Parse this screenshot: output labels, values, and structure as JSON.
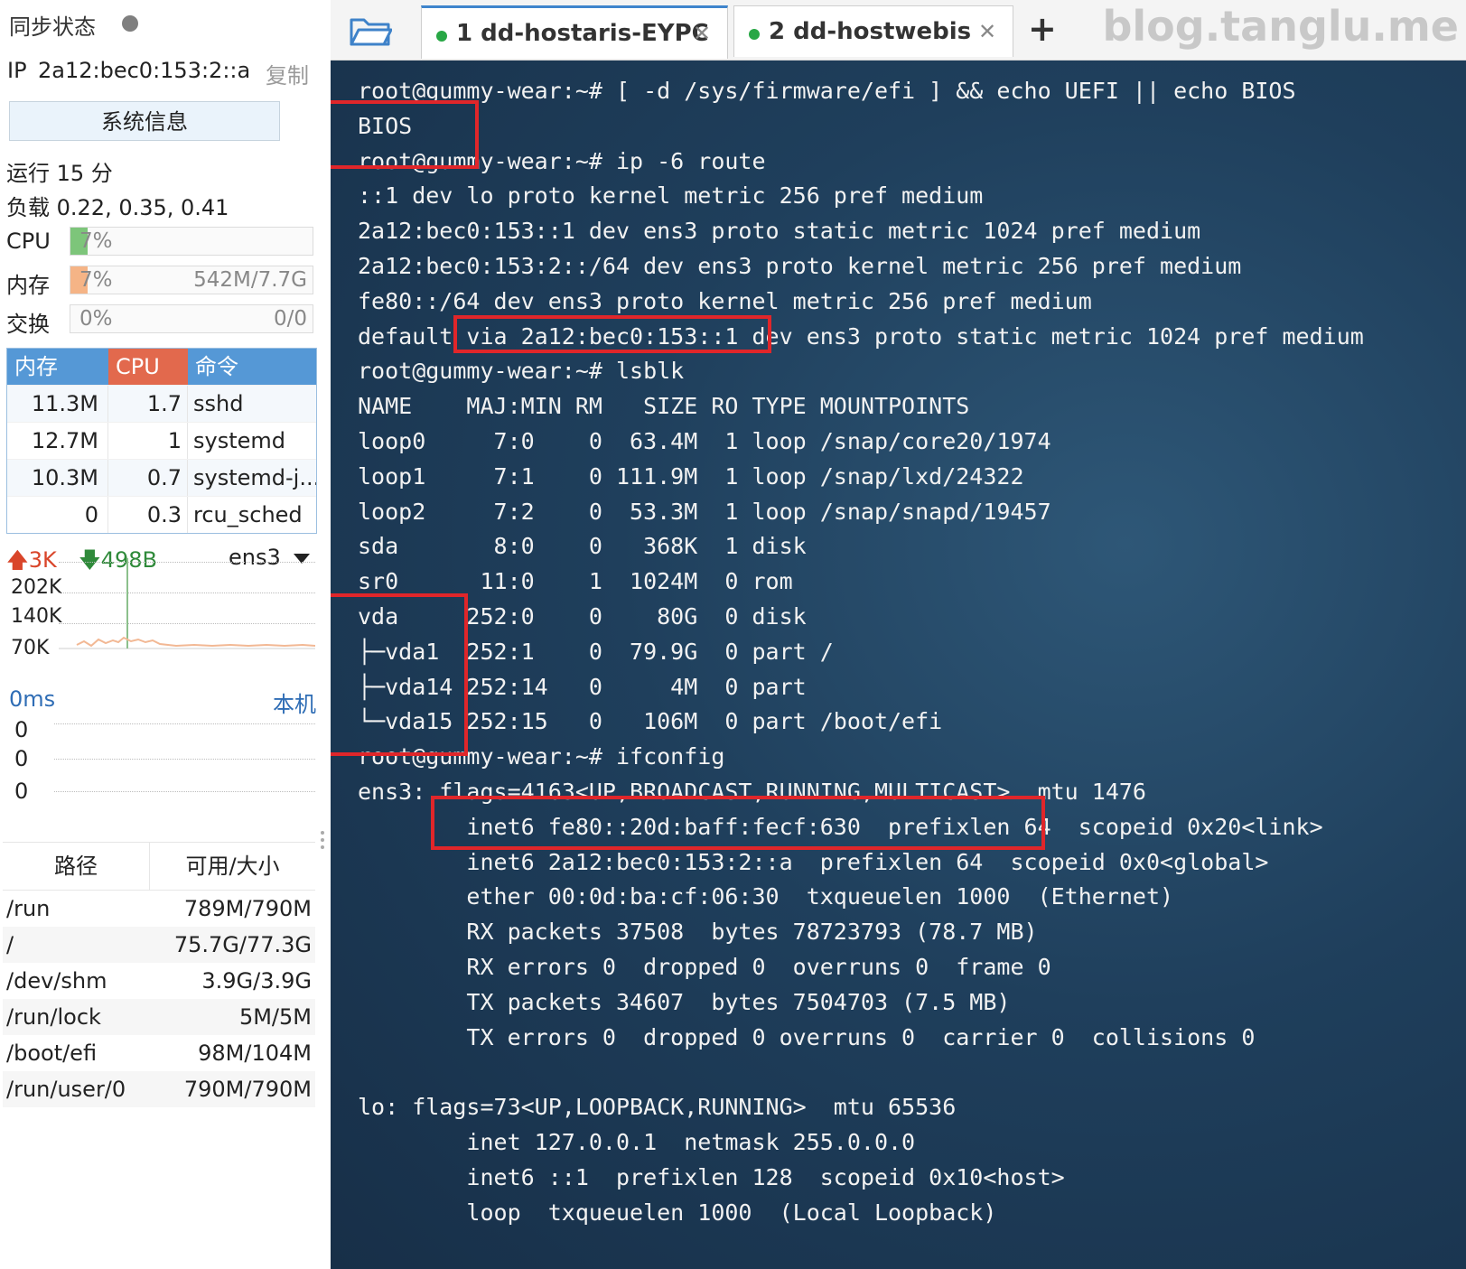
{
  "sidebar": {
    "sync_label": "同步状态",
    "ip_label": "IP",
    "ip_value": "2a12:bec0:153:2::a",
    "copy_label": "复制",
    "sysinfo_button": "系统信息",
    "uptime": "运行 15 分",
    "load": "负载 0.22, 0.35, 0.41",
    "meters": [
      {
        "label": "CPU",
        "percent": "7%",
        "extra": "",
        "fill_fraction": 0.07,
        "color": "#7dc57a"
      },
      {
        "label": "内存",
        "percent": "7%",
        "extra": "542M/7.7G",
        "fill_fraction": 0.07,
        "color": "#f5b486"
      },
      {
        "label": "交换",
        "percent": "0%",
        "extra": "0/0",
        "fill_fraction": 0.0,
        "color": "#7dc57a"
      }
    ],
    "process_table": {
      "headers": [
        "内存",
        "CPU",
        "命令"
      ],
      "rows": [
        {
          "mem": "11.3M",
          "cpu": "1.7",
          "cmd": "sshd"
        },
        {
          "mem": "12.7M",
          "cpu": "1",
          "cmd": "systemd"
        },
        {
          "mem": "10.3M",
          "cpu": "0.7",
          "cmd": "systemd-j..."
        },
        {
          "mem": "0",
          "cpu": "0.3",
          "cmd": "rcu_sched"
        }
      ]
    },
    "network": {
      "upload": "3K",
      "download": "498B",
      "interface": "ens3",
      "y_ticks": [
        "202K",
        "140K",
        "70K"
      ]
    },
    "ping": {
      "latency": "0ms",
      "host": "本机",
      "values": [
        "0",
        "0",
        "0"
      ]
    },
    "disk_table": {
      "headers": [
        "路径",
        "可用/大小"
      ],
      "rows": [
        {
          "path": "/run",
          "size": "789M/790M"
        },
        {
          "path": "/",
          "size": "75.7G/77.3G"
        },
        {
          "path": "/dev/shm",
          "size": "3.9G/3.9G"
        },
        {
          "path": "/run/lock",
          "size": "5M/5M"
        },
        {
          "path": "/boot/efi",
          "size": "98M/104M"
        },
        {
          "path": "/run/user/0",
          "size": "790M/790M"
        }
      ]
    }
  },
  "tabs": [
    {
      "label": "1  dd-hostaris-EYPC",
      "active": true
    },
    {
      "label": "2  dd-hostwebis",
      "active": false
    }
  ],
  "watermark": "blog.tanglu.me",
  "terminal": {
    "lines": [
      "root@gummy-wear:~# [ -d /sys/firmware/efi ] && echo UEFI || echo BIOS",
      "BIOS",
      "root@gummy-wear:~# ip -6 route",
      "::1 dev lo proto kernel metric 256 pref medium",
      "2a12:bec0:153::1 dev ens3 proto static metric 1024 pref medium",
      "2a12:bec0:153:2::/64 dev ens3 proto kernel metric 256 pref medium",
      "fe80::/64 dev ens3 proto kernel metric 256 pref medium",
      "default via 2a12:bec0:153::1 dev ens3 proto static metric 1024 pref medium",
      "root@gummy-wear:~# lsblk",
      "NAME    MAJ:MIN RM   SIZE RO TYPE MOUNTPOINTS",
      "loop0     7:0    0  63.4M  1 loop /snap/core20/1974",
      "loop1     7:1    0 111.9M  1 loop /snap/lxd/24322",
      "loop2     7:2    0  53.3M  1 loop /snap/snapd/19457",
      "sda       8:0    0   368K  1 disk",
      "sr0      11:0    1  1024M  0 rom",
      "vda     252:0    0    80G  0 disk",
      "├─vda1  252:1    0  79.9G  0 part /",
      "├─vda14 252:14   0     4M  0 part",
      "└─vda15 252:15   0   106M  0 part /boot/efi",
      "root@gummy-wear:~# ifconfig",
      "ens3: flags=4163<UP,BROADCAST,RUNNING,MULTICAST>  mtu 1476",
      "        inet6 fe80::20d:baff:fecf:630  prefixlen 64  scopeid 0x20<link>",
      "        inet6 2a12:bec0:153:2::a  prefixlen 64  scopeid 0x0<global>",
      "        ether 00:0d:ba:cf:06:30  txqueuelen 1000  (Ethernet)",
      "        RX packets 37508  bytes 78723793 (78.7 MB)",
      "        RX errors 0  dropped 0  overruns 0  frame 0",
      "        TX packets 34607  bytes 7504703 (7.5 MB)",
      "        TX errors 0  dropped 0 overruns 0  carrier 0  collisions 0",
      "",
      "lo: flags=73<UP,LOOPBACK,RUNNING>  mtu 65536",
      "        inet 127.0.0.1  netmask 255.0.0.0",
      "        inet6 ::1  prefixlen 128  scopeid 0x10<host>",
      "        loop  txqueuelen 1000  (Local Loopback)"
    ]
  }
}
